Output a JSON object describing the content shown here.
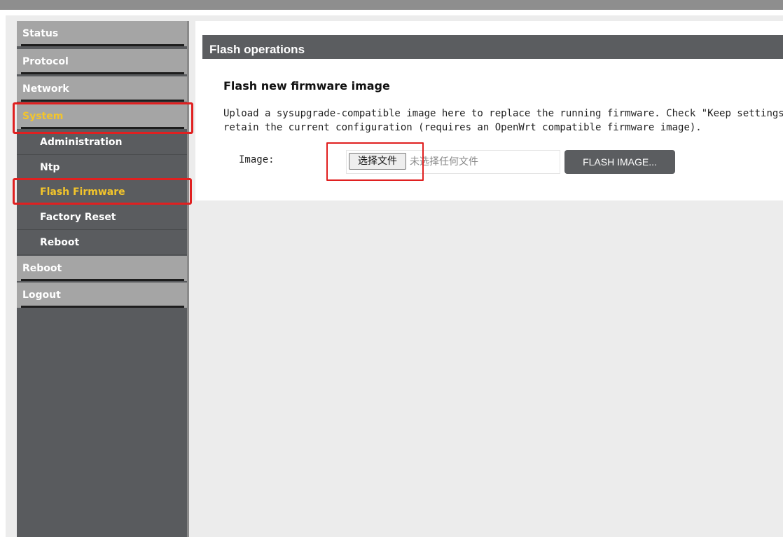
{
  "sidebar": {
    "top_items": [
      {
        "label": "Status"
      },
      {
        "label": "Protocol"
      },
      {
        "label": "Network"
      },
      {
        "label": "System"
      },
      {
        "label": "Reboot"
      },
      {
        "label": "Logout"
      }
    ],
    "sub_items": [
      {
        "label": "Administration"
      },
      {
        "label": "Ntp"
      },
      {
        "label": "Flash Firmware"
      },
      {
        "label": "Factory Reset"
      },
      {
        "label": "Reboot"
      }
    ]
  },
  "main": {
    "panel_title": "Flash operations",
    "section_title": "Flash new firmware image",
    "description_line1": "Upload a sysupgrade-compatible image here to replace the running firmware. Check \"Keep settings\" t",
    "description_line2": "retain the current configuration (requires an OpenWrt compatible firmware image).",
    "image_label": "Image:",
    "choose_file_label": "选择文件",
    "no_file_text": "未选择任何文件",
    "flash_button_label": "FLASH IMAGE..."
  },
  "colors": {
    "accent": "#f3c52b",
    "sidebar_bg": "#595b5e",
    "highlight": "#e02020",
    "header_bg": "#5b5d60"
  }
}
